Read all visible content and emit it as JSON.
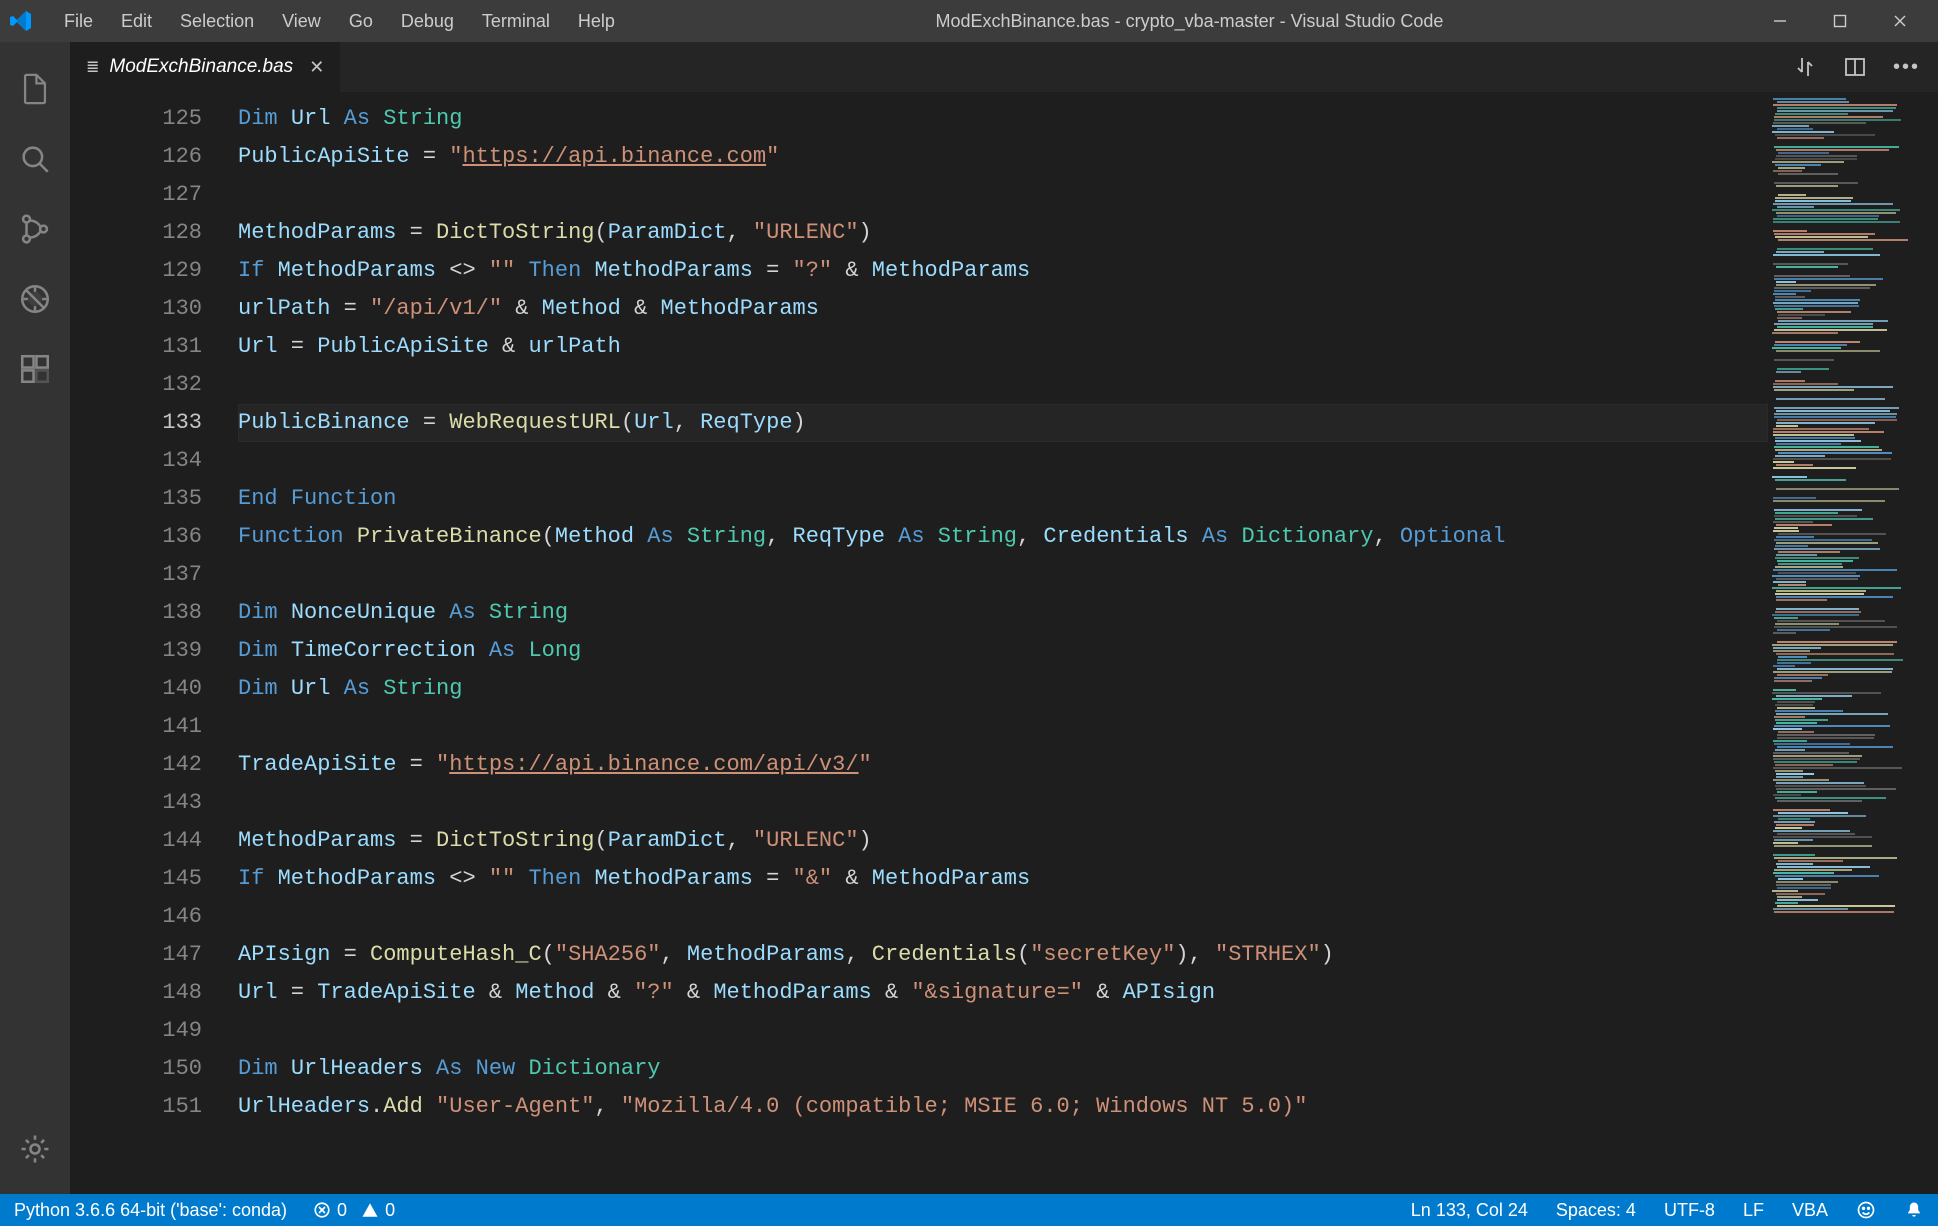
{
  "titlebar": {
    "menu": [
      "File",
      "Edit",
      "Selection",
      "View",
      "Go",
      "Debug",
      "Terminal",
      "Help"
    ],
    "title": "ModExchBinance.bas - crypto_vba-master - Visual Studio Code"
  },
  "tab": {
    "name": "ModExchBinance.bas"
  },
  "lines": [
    {
      "n": 125,
      "t": [
        [
          "kw",
          "Dim"
        ],
        [
          "",
          " "
        ],
        [
          "var",
          "Url"
        ],
        [
          "",
          " "
        ],
        [
          "kw",
          "As"
        ],
        [
          "",
          " "
        ],
        [
          "type",
          "String"
        ]
      ]
    },
    {
      "n": 126,
      "t": [
        [
          "var",
          "PublicApiSite"
        ],
        [
          "",
          " = "
        ],
        [
          "str",
          "\""
        ],
        [
          "url",
          "https://api.binance.com"
        ],
        [
          "str",
          "\""
        ]
      ]
    },
    {
      "n": 127,
      "t": []
    },
    {
      "n": 128,
      "t": [
        [
          "var",
          "MethodParams"
        ],
        [
          "",
          " = "
        ],
        [
          "fn",
          "DictToString"
        ],
        [
          "",
          "("
        ],
        [
          "var",
          "ParamDict"
        ],
        [
          "",
          ", "
        ],
        [
          "str",
          "\"URLENC\""
        ],
        [
          "",
          ")"
        ]
      ]
    },
    {
      "n": 129,
      "t": [
        [
          "kw",
          "If"
        ],
        [
          "",
          " "
        ],
        [
          "var",
          "MethodParams"
        ],
        [
          "",
          " <> "
        ],
        [
          "str",
          "\"\""
        ],
        [
          "",
          " "
        ],
        [
          "kw",
          "Then"
        ],
        [
          "",
          " "
        ],
        [
          "var",
          "MethodParams"
        ],
        [
          "",
          " = "
        ],
        [
          "str",
          "\"?\""
        ],
        [
          "",
          " & "
        ],
        [
          "var",
          "MethodParams"
        ]
      ]
    },
    {
      "n": 130,
      "t": [
        [
          "var",
          "urlPath"
        ],
        [
          "",
          " = "
        ],
        [
          "str",
          "\"/api/v1/\""
        ],
        [
          "",
          " & "
        ],
        [
          "var",
          "Method"
        ],
        [
          "",
          " & "
        ],
        [
          "var",
          "MethodParams"
        ]
      ]
    },
    {
      "n": 131,
      "t": [
        [
          "var",
          "Url"
        ],
        [
          "",
          " = "
        ],
        [
          "var",
          "PublicApiSite"
        ],
        [
          "",
          " & "
        ],
        [
          "var",
          "urlPath"
        ]
      ]
    },
    {
      "n": 132,
      "t": []
    },
    {
      "n": 133,
      "current": true,
      "t": [
        [
          "var",
          "PublicBinance"
        ],
        [
          "",
          " = "
        ],
        [
          "fn",
          "WebRequestURL"
        ],
        [
          "",
          "("
        ],
        [
          "var",
          "Url"
        ],
        [
          "",
          ", "
        ],
        [
          "var",
          "ReqType"
        ],
        [
          "",
          ")"
        ]
      ]
    },
    {
      "n": 134,
      "t": []
    },
    {
      "n": 135,
      "t": [
        [
          "kw",
          "End"
        ],
        [
          "",
          " "
        ],
        [
          "kw",
          "Function"
        ]
      ]
    },
    {
      "n": 136,
      "t": [
        [
          "kw",
          "Function"
        ],
        [
          "",
          " "
        ],
        [
          "fn",
          "PrivateBinance"
        ],
        [
          "",
          "("
        ],
        [
          "var",
          "Method"
        ],
        [
          "",
          " "
        ],
        [
          "kw",
          "As"
        ],
        [
          "",
          " "
        ],
        [
          "type",
          "String"
        ],
        [
          "",
          ", "
        ],
        [
          "var",
          "ReqType"
        ],
        [
          "",
          " "
        ],
        [
          "kw",
          "As"
        ],
        [
          "",
          " "
        ],
        [
          "type",
          "String"
        ],
        [
          "",
          ", "
        ],
        [
          "var",
          "Credentials"
        ],
        [
          "",
          " "
        ],
        [
          "kw",
          "As"
        ],
        [
          "",
          " "
        ],
        [
          "type",
          "Dictionary"
        ],
        [
          "",
          ", "
        ],
        [
          "kw",
          "Optional"
        ]
      ]
    },
    {
      "n": 137,
      "t": []
    },
    {
      "n": 138,
      "t": [
        [
          "kw",
          "Dim"
        ],
        [
          "",
          " "
        ],
        [
          "var",
          "NonceUnique"
        ],
        [
          "",
          " "
        ],
        [
          "kw",
          "As"
        ],
        [
          "",
          " "
        ],
        [
          "type",
          "String"
        ]
      ]
    },
    {
      "n": 139,
      "t": [
        [
          "kw",
          "Dim"
        ],
        [
          "",
          " "
        ],
        [
          "var",
          "TimeCorrection"
        ],
        [
          "",
          " "
        ],
        [
          "kw",
          "As"
        ],
        [
          "",
          " "
        ],
        [
          "type",
          "Long"
        ]
      ]
    },
    {
      "n": 140,
      "t": [
        [
          "kw",
          "Dim"
        ],
        [
          "",
          " "
        ],
        [
          "var",
          "Url"
        ],
        [
          "",
          " "
        ],
        [
          "kw",
          "As"
        ],
        [
          "",
          " "
        ],
        [
          "type",
          "String"
        ]
      ]
    },
    {
      "n": 141,
      "t": []
    },
    {
      "n": 142,
      "t": [
        [
          "var",
          "TradeApiSite"
        ],
        [
          "",
          " = "
        ],
        [
          "str",
          "\""
        ],
        [
          "url",
          "https://api.binance.com/api/v3/"
        ],
        [
          "str",
          "\""
        ]
      ]
    },
    {
      "n": 143,
      "t": []
    },
    {
      "n": 144,
      "t": [
        [
          "var",
          "MethodParams"
        ],
        [
          "",
          " = "
        ],
        [
          "fn",
          "DictToString"
        ],
        [
          "",
          "("
        ],
        [
          "var",
          "ParamDict"
        ],
        [
          "",
          ", "
        ],
        [
          "str",
          "\"URLENC\""
        ],
        [
          "",
          ")"
        ]
      ]
    },
    {
      "n": 145,
      "t": [
        [
          "kw",
          "If"
        ],
        [
          "",
          " "
        ],
        [
          "var",
          "MethodParams"
        ],
        [
          "",
          " <> "
        ],
        [
          "str",
          "\"\""
        ],
        [
          "",
          " "
        ],
        [
          "kw",
          "Then"
        ],
        [
          "",
          " "
        ],
        [
          "var",
          "MethodParams"
        ],
        [
          "",
          " = "
        ],
        [
          "str",
          "\"&\""
        ],
        [
          "",
          " & "
        ],
        [
          "var",
          "MethodParams"
        ]
      ]
    },
    {
      "n": 146,
      "t": []
    },
    {
      "n": 147,
      "t": [
        [
          "var",
          "APIsign"
        ],
        [
          "",
          " = "
        ],
        [
          "fn",
          "ComputeHash_C"
        ],
        [
          "",
          "("
        ],
        [
          "str",
          "\"SHA256\""
        ],
        [
          "",
          ", "
        ],
        [
          "var",
          "MethodParams"
        ],
        [
          "",
          ", "
        ],
        [
          "fn",
          "Credentials"
        ],
        [
          "",
          "("
        ],
        [
          "str",
          "\"secretKey\""
        ],
        [
          "",
          "), "
        ],
        [
          "str",
          "\"STRHEX\""
        ],
        [
          "",
          ")"
        ]
      ]
    },
    {
      "n": 148,
      "t": [
        [
          "var",
          "Url"
        ],
        [
          "",
          " = "
        ],
        [
          "var",
          "TradeApiSite"
        ],
        [
          "",
          " & "
        ],
        [
          "var",
          "Method"
        ],
        [
          "",
          " & "
        ],
        [
          "str",
          "\"?\""
        ],
        [
          "",
          " & "
        ],
        [
          "var",
          "MethodParams"
        ],
        [
          "",
          " & "
        ],
        [
          "str",
          "\"&signature=\""
        ],
        [
          "",
          " & "
        ],
        [
          "var",
          "APIsign"
        ]
      ]
    },
    {
      "n": 149,
      "t": []
    },
    {
      "n": 150,
      "t": [
        [
          "kw",
          "Dim"
        ],
        [
          "",
          " "
        ],
        [
          "var",
          "UrlHeaders"
        ],
        [
          "",
          " "
        ],
        [
          "kw",
          "As"
        ],
        [
          "",
          " "
        ],
        [
          "kw",
          "New"
        ],
        [
          "",
          " "
        ],
        [
          "type",
          "Dictionary"
        ]
      ]
    },
    {
      "n": 151,
      "t": [
        [
          "var",
          "UrlHeaders"
        ],
        [
          "",
          "."
        ],
        [
          "fn",
          "Add"
        ],
        [
          "",
          " "
        ],
        [
          "str",
          "\"User-Agent\""
        ],
        [
          "",
          ", "
        ],
        [
          "str",
          "\"Mozilla/4.0 (compatible; MSIE 6.0; Windows NT 5.0)\""
        ]
      ]
    }
  ],
  "status": {
    "python": "Python 3.6.6 64-bit ('base': conda)",
    "errors": "0",
    "warnings": "0",
    "cursor": "Ln 133, Col 24",
    "spaces": "Spaces: 4",
    "encoding": "UTF-8",
    "eol": "LF",
    "lang": "VBA"
  }
}
